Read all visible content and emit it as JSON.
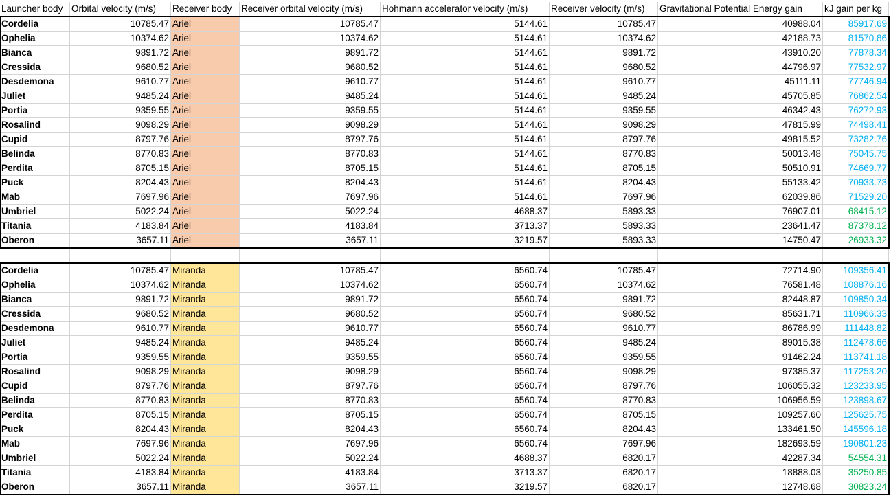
{
  "colors": {
    "ariel_fill": "#f8cbad",
    "miranda_fill": "#ffe699",
    "blue_text": "#00b0f0",
    "green_text": "#00b050"
  },
  "headers": [
    "Launcher body",
    "Orbital velocity (m/s)",
    "Receiver body",
    "Receiver orbital velocity (m/s)",
    "Hohmann accelerator velocity (m/s)",
    "Receiver velocity (m/s)",
    "Gravitational Potential Energy gain",
    "kJ gain per kg"
  ],
  "ariel_rows": [
    {
      "launcher": "Cordelia",
      "orbital": "10785.47",
      "receiver": "Ariel",
      "recv_orbital": "10785.47",
      "hohmann": "5144.61",
      "recv_vel": "10785.47",
      "gpe": "40988.04",
      "kj": "85917.69",
      "kj_color": "blue"
    },
    {
      "launcher": "Ophelia",
      "orbital": "10374.62",
      "receiver": "Ariel",
      "recv_orbital": "10374.62",
      "hohmann": "5144.61",
      "recv_vel": "10374.62",
      "gpe": "42188.73",
      "kj": "81570.86",
      "kj_color": "blue"
    },
    {
      "launcher": "Bianca",
      "orbital": "9891.72",
      "receiver": "Ariel",
      "recv_orbital": "9891.72",
      "hohmann": "5144.61",
      "recv_vel": "9891.72",
      "gpe": "43910.20",
      "kj": "77878.34",
      "kj_color": "blue"
    },
    {
      "launcher": "Cressida",
      "orbital": "9680.52",
      "receiver": "Ariel",
      "recv_orbital": "9680.52",
      "hohmann": "5144.61",
      "recv_vel": "9680.52",
      "gpe": "44796.97",
      "kj": "77532.97",
      "kj_color": "blue"
    },
    {
      "launcher": "Desdemona",
      "orbital": "9610.77",
      "receiver": "Ariel",
      "recv_orbital": "9610.77",
      "hohmann": "5144.61",
      "recv_vel": "9610.77",
      "gpe": "45111.11",
      "kj": "77746.94",
      "kj_color": "blue"
    },
    {
      "launcher": "Juliet",
      "orbital": "9485.24",
      "receiver": "Ariel",
      "recv_orbital": "9485.24",
      "hohmann": "5144.61",
      "recv_vel": "9485.24",
      "gpe": "45705.85",
      "kj": "76862.54",
      "kj_color": "blue"
    },
    {
      "launcher": "Portia",
      "orbital": "9359.55",
      "receiver": "Ariel",
      "recv_orbital": "9359.55",
      "hohmann": "5144.61",
      "recv_vel": "9359.55",
      "gpe": "46342.43",
      "kj": "76272.93",
      "kj_color": "blue"
    },
    {
      "launcher": "Rosalind",
      "orbital": "9098.29",
      "receiver": "Ariel",
      "recv_orbital": "9098.29",
      "hohmann": "5144.61",
      "recv_vel": "9098.29",
      "gpe": "47815.99",
      "kj": "74498.41",
      "kj_color": "blue"
    },
    {
      "launcher": "Cupid",
      "orbital": "8797.76",
      "receiver": "Ariel",
      "recv_orbital": "8797.76",
      "hohmann": "5144.61",
      "recv_vel": "8797.76",
      "gpe": "49815.52",
      "kj": "73282.76",
      "kj_color": "blue"
    },
    {
      "launcher": "Belinda",
      "orbital": "8770.83",
      "receiver": "Ariel",
      "recv_orbital": "8770.83",
      "hohmann": "5144.61",
      "recv_vel": "8770.83",
      "gpe": "50013.48",
      "kj": "75045.75",
      "kj_color": "blue"
    },
    {
      "launcher": "Perdita",
      "orbital": "8705.15",
      "receiver": "Ariel",
      "recv_orbital": "8705.15",
      "hohmann": "5144.61",
      "recv_vel": "8705.15",
      "gpe": "50510.91",
      "kj": "74669.77",
      "kj_color": "blue"
    },
    {
      "launcher": "Puck",
      "orbital": "8204.43",
      "receiver": "Ariel",
      "recv_orbital": "8204.43",
      "hohmann": "5144.61",
      "recv_vel": "8204.43",
      "gpe": "55133.42",
      "kj": "70933.73",
      "kj_color": "blue"
    },
    {
      "launcher": "Mab",
      "orbital": "7697.96",
      "receiver": "Ariel",
      "recv_orbital": "7697.96",
      "hohmann": "5144.61",
      "recv_vel": "7697.96",
      "gpe": "62039.86",
      "kj": "71529.20",
      "kj_color": "blue"
    },
    {
      "launcher": "Umbriel",
      "orbital": "5022.24",
      "receiver": "Ariel",
      "recv_orbital": "5022.24",
      "hohmann": "4688.37",
      "recv_vel": "5893.33",
      "gpe": "76907.01",
      "kj": "68415.12",
      "kj_color": "green"
    },
    {
      "launcher": "Titania",
      "orbital": "4183.84",
      "receiver": "Ariel",
      "recv_orbital": "4183.84",
      "hohmann": "3713.37",
      "recv_vel": "5893.33",
      "gpe": "23641.47",
      "kj": "87378.12",
      "kj_color": "green"
    },
    {
      "launcher": "Oberon",
      "orbital": "3657.11",
      "receiver": "Ariel",
      "recv_orbital": "3657.11",
      "hohmann": "3219.57",
      "recv_vel": "5893.33",
      "gpe": "14750.47",
      "kj": "26933.32",
      "kj_color": "green"
    }
  ],
  "miranda_rows": [
    {
      "launcher": "Cordelia",
      "orbital": "10785.47",
      "receiver": "Miranda",
      "recv_orbital": "10785.47",
      "hohmann": "6560.74",
      "recv_vel": "10785.47",
      "gpe": "72714.90",
      "kj": "109356.41",
      "kj_color": "blue"
    },
    {
      "launcher": "Ophelia",
      "orbital": "10374.62",
      "receiver": "Miranda",
      "recv_orbital": "10374.62",
      "hohmann": "6560.74",
      "recv_vel": "10374.62",
      "gpe": "76581.48",
      "kj": "108876.16",
      "kj_color": "blue"
    },
    {
      "launcher": "Bianca",
      "orbital": "9891.72",
      "receiver": "Miranda",
      "recv_orbital": "9891.72",
      "hohmann": "6560.74",
      "recv_vel": "9891.72",
      "gpe": "82448.87",
      "kj": "109850.34",
      "kj_color": "blue"
    },
    {
      "launcher": "Cressida",
      "orbital": "9680.52",
      "receiver": "Miranda",
      "recv_orbital": "9680.52",
      "hohmann": "6560.74",
      "recv_vel": "9680.52",
      "gpe": "85631.71",
      "kj": "110966.33",
      "kj_color": "blue"
    },
    {
      "launcher": "Desdemona",
      "orbital": "9610.77",
      "receiver": "Miranda",
      "recv_orbital": "9610.77",
      "hohmann": "6560.74",
      "recv_vel": "9610.77",
      "gpe": "86786.99",
      "kj": "111448.82",
      "kj_color": "blue"
    },
    {
      "launcher": "Juliet",
      "orbital": "9485.24",
      "receiver": "Miranda",
      "recv_orbital": "9485.24",
      "hohmann": "6560.74",
      "recv_vel": "9485.24",
      "gpe": "89015.38",
      "kj": "112478.66",
      "kj_color": "blue"
    },
    {
      "launcher": "Portia",
      "orbital": "9359.55",
      "receiver": "Miranda",
      "recv_orbital": "9359.55",
      "hohmann": "6560.74",
      "recv_vel": "9359.55",
      "gpe": "91462.24",
      "kj": "113741.18",
      "kj_color": "blue"
    },
    {
      "launcher": "Rosalind",
      "orbital": "9098.29",
      "receiver": "Miranda",
      "recv_orbital": "9098.29",
      "hohmann": "6560.74",
      "recv_vel": "9098.29",
      "gpe": "97385.37",
      "kj": "117253.20",
      "kj_color": "blue"
    },
    {
      "launcher": "Cupid",
      "orbital": "8797.76",
      "receiver": "Miranda",
      "recv_orbital": "8797.76",
      "hohmann": "6560.74",
      "recv_vel": "8797.76",
      "gpe": "106055.32",
      "kj": "123233.95",
      "kj_color": "blue"
    },
    {
      "launcher": "Belinda",
      "orbital": "8770.83",
      "receiver": "Miranda",
      "recv_orbital": "8770.83",
      "hohmann": "6560.74",
      "recv_vel": "8770.83",
      "gpe": "106956.59",
      "kj": "123898.67",
      "kj_color": "blue"
    },
    {
      "launcher": "Perdita",
      "orbital": "8705.15",
      "receiver": "Miranda",
      "recv_orbital": "8705.15",
      "hohmann": "6560.74",
      "recv_vel": "8705.15",
      "gpe": "109257.60",
      "kj": "125625.75",
      "kj_color": "blue"
    },
    {
      "launcher": "Puck",
      "orbital": "8204.43",
      "receiver": "Miranda",
      "recv_orbital": "8204.43",
      "hohmann": "6560.74",
      "recv_vel": "8204.43",
      "gpe": "133461.50",
      "kj": "145596.18",
      "kj_color": "blue"
    },
    {
      "launcher": "Mab",
      "orbital": "7697.96",
      "receiver": "Miranda",
      "recv_orbital": "7697.96",
      "hohmann": "6560.74",
      "recv_vel": "7697.96",
      "gpe": "182693.59",
      "kj": "190801.23",
      "kj_color": "blue"
    },
    {
      "launcher": "Umbriel",
      "orbital": "5022.24",
      "receiver": "Miranda",
      "recv_orbital": "5022.24",
      "hohmann": "4688.37",
      "recv_vel": "6820.17",
      "gpe": "42287.34",
      "kj": "54554.31",
      "kj_color": "green"
    },
    {
      "launcher": "Titania",
      "orbital": "4183.84",
      "receiver": "Miranda",
      "recv_orbital": "4183.84",
      "hohmann": "3713.37",
      "recv_vel": "6820.17",
      "gpe": "18888.03",
      "kj": "35250.85",
      "kj_color": "green"
    },
    {
      "launcher": "Oberon",
      "orbital": "3657.11",
      "receiver": "Miranda",
      "recv_orbital": "3657.11",
      "hohmann": "3219.57",
      "recv_vel": "6820.17",
      "gpe": "12748.68",
      "kj": "30823.24",
      "kj_color": "green"
    }
  ]
}
